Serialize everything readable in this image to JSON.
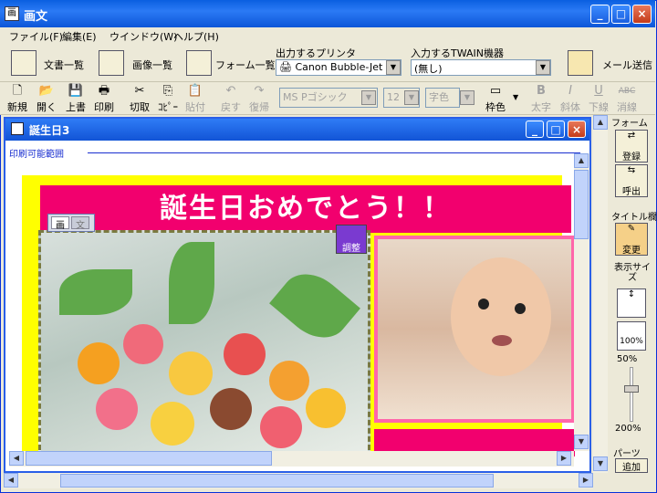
{
  "window": {
    "title": "画文"
  },
  "menus": [
    {
      "label": "ファイル(F)"
    },
    {
      "label": "編集(E)"
    },
    {
      "label": "ウインドウ(W)"
    },
    {
      "label": "ヘルプ(H)"
    }
  ],
  "toolbar1": {
    "doc_list": "文書一覧",
    "image_list": "画像一覧",
    "form_list": "フォーム一覧",
    "printer_label": "出力するプリンタ",
    "printer_value": "Canon Bubble-Jet",
    "twain_label": "入力するTWAIN機器",
    "twain_value": "(無し)",
    "mail_label": "メール送信"
  },
  "toolbar2": {
    "new": "新規",
    "open": "開く",
    "overwrite": "上書",
    "print": "印刷",
    "cut": "切取",
    "copy": "ｺﾋﾟｰ",
    "paste": "貼付",
    "undo": "戻す",
    "redo": "復帰",
    "font": "MS Pゴシック",
    "size": "12",
    "color": "字色",
    "border": "枠色",
    "bold": "太字",
    "italic": "斜体",
    "underline": "下線",
    "strike": "消線"
  },
  "document": {
    "title": "誕生日3",
    "print_area": "印刷可能範囲",
    "banner": "誕生日おめでとう！！",
    "tab_image": "画",
    "tab_text": "文",
    "adjust": "調整"
  },
  "right_panel": {
    "form": "フォーム",
    "register": "登録",
    "recall": "呼出",
    "title_section": "タイトル欄",
    "change": "変更",
    "display_size": "表示サイズ",
    "percent_100": "100%",
    "zoom_min": "50%",
    "zoom_max": "200%",
    "parts": "パーツ",
    "add": "追加"
  },
  "colors": {
    "title_blue": "#0a5fe0",
    "banner_magenta": "#f2006e",
    "canvas_yellow": "#ffff00"
  }
}
